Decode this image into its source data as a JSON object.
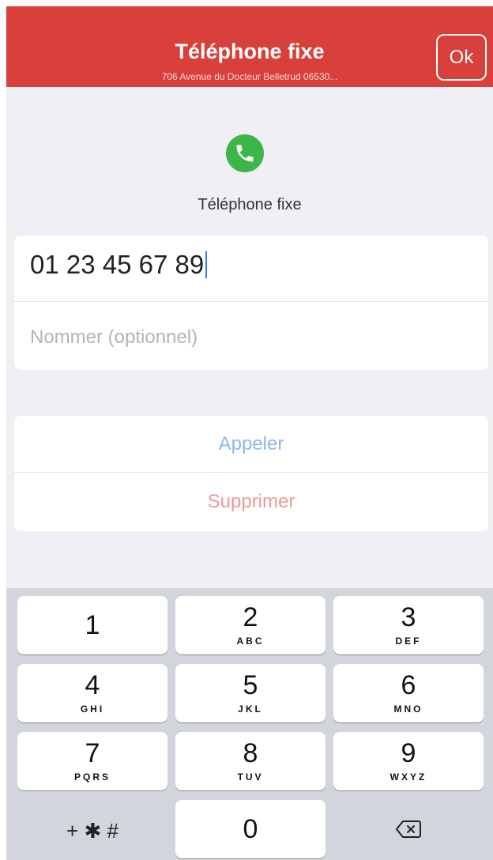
{
  "header": {
    "title": "Téléphone fixe",
    "subtitle": "706 Avenue du Docteur Belletrud 06530...",
    "ok_label": "Ok",
    "color": "#d9403b"
  },
  "contact_type": {
    "icon": "phone-icon",
    "label": "Téléphone fixe",
    "icon_color": "#3cb549"
  },
  "form": {
    "phone_value": "01 23 45 67 89",
    "name_placeholder": "Nommer (optionnel)"
  },
  "actions": {
    "call_label": "Appeler",
    "delete_label": "Supprimer"
  },
  "keypad": {
    "keys": [
      {
        "num": "1",
        "letters": ""
      },
      {
        "num": "2",
        "letters": "ABC"
      },
      {
        "num": "3",
        "letters": "DEF"
      },
      {
        "num": "4",
        "letters": "GHI"
      },
      {
        "num": "5",
        "letters": "JKL"
      },
      {
        "num": "6",
        "letters": "MNO"
      },
      {
        "num": "7",
        "letters": "PQRS"
      },
      {
        "num": "8",
        "letters": "TUV"
      },
      {
        "num": "9",
        "letters": "WXYZ"
      },
      {
        "num": "0",
        "letters": ""
      }
    ],
    "symbols_label": "+ ✱ #",
    "backspace_icon": "backspace-icon"
  }
}
